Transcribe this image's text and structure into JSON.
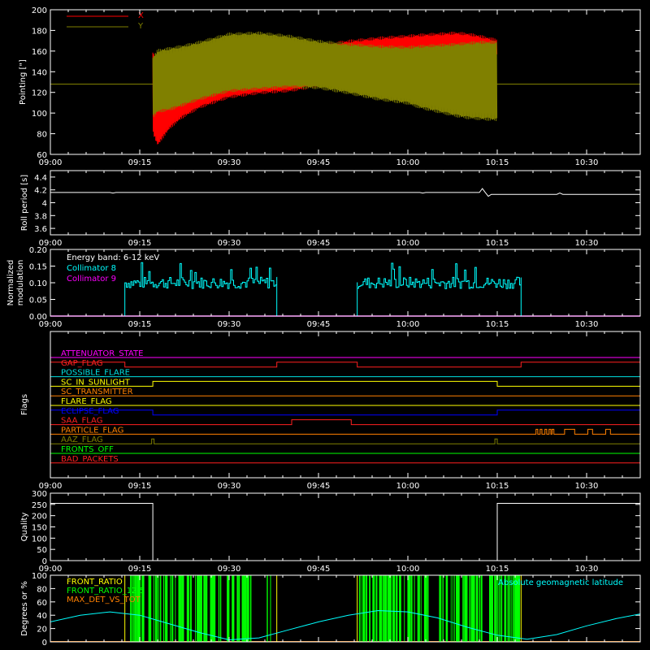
{
  "colors": {
    "background": "#000000",
    "axis": "#ffffff",
    "x_pointing": "#ff0000",
    "y_pointing": "#808000",
    "roll": "#ffffff",
    "collimator8": "#00ffff",
    "collimator9": "#ff00ff",
    "quality": "#ffffff",
    "front_ratio": "#ffff00",
    "front_ratio_125": "#00ff00",
    "max_det": "#ff8000",
    "geomag": "#00ffff"
  },
  "time_axis": {
    "ticks": [
      "09:00",
      "09:15",
      "09:30",
      "09:45",
      "10:00",
      "10:15",
      "10:30"
    ],
    "tick_minutes": [
      0,
      15,
      30,
      45,
      60,
      75,
      90
    ],
    "range_minutes": [
      0,
      99
    ]
  },
  "chart_data": [
    {
      "id": "pointing",
      "type": "line",
      "ylabel": "Pointing [\"]",
      "ylim": [
        60,
        200
      ],
      "yticks": [
        60,
        80,
        100,
        120,
        140,
        160,
        180,
        200
      ],
      "legend": [
        "X",
        "Y"
      ],
      "baseline_value": 128,
      "data_start_min": 17.2,
      "data_end_min": 75.0,
      "series": [
        {
          "name": "X",
          "x": [
            17.2,
            18,
            20,
            22,
            25,
            30,
            35,
            40,
            45,
            50,
            55,
            60,
            62,
            65,
            68,
            70,
            72,
            75
          ],
          "upper": [
            160,
            150,
            150,
            152,
            155,
            160,
            163,
            165,
            167,
            171,
            174,
            176,
            177,
            178,
            179,
            178,
            176,
            172
          ],
          "lower": [
            80,
            68,
            84,
            94,
            104,
            114,
            118,
            120,
            125,
            130,
            134,
            138,
            140,
            141,
            144,
            147,
            150,
            154
          ]
        },
        {
          "name": "Y",
          "x": [
            17.2,
            18,
            20,
            22,
            25,
            30,
            35,
            40,
            45,
            50,
            55,
            60,
            62,
            65,
            68,
            70,
            72,
            75
          ],
          "upper": [
            155,
            162,
            164,
            166,
            170,
            178,
            179,
            176,
            171,
            168,
            166,
            165,
            166,
            167,
            168,
            169,
            170,
            170
          ],
          "lower": [
            95,
            100,
            102,
            106,
            112,
            120,
            122,
            124,
            123,
            118,
            112,
            108,
            104,
            100,
            96,
            94,
            93,
            92
          ]
        }
      ]
    },
    {
      "id": "roll",
      "type": "line",
      "ylabel": "Roll period [s]",
      "ylim": [
        3.5,
        4.5
      ],
      "yticks": [
        3.6,
        3.8,
        4.0,
        4.2,
        4.4
      ],
      "series": [
        {
          "name": "",
          "x": [
            0,
            10,
            10.5,
            11,
            20,
            30,
            40,
            50,
            60,
            62,
            62.5,
            63,
            70,
            72,
            72.5,
            73,
            73.5,
            74,
            80,
            85,
            85.5,
            86,
            99
          ],
          "values": [
            4.16,
            4.16,
            4.15,
            4.16,
            4.16,
            4.16,
            4.16,
            4.16,
            4.16,
            4.16,
            4.15,
            4.16,
            4.16,
            4.16,
            4.22,
            4.16,
            4.1,
            4.13,
            4.13,
            4.13,
            4.15,
            4.13,
            4.13
          ]
        }
      ]
    },
    {
      "id": "modulation",
      "type": "line",
      "ylabel": "Normalized modulation",
      "ylim": [
        0,
        0.2
      ],
      "yticks": [
        "0.00",
        "0.05",
        "0.10",
        "0.15",
        "0.20"
      ],
      "annotation": "Energy band: 6-12 keV",
      "legend": [
        "Collimator 8",
        "Collimator 9"
      ],
      "segments": [
        [
          12.5,
          38.0
        ],
        [
          51.5,
          79.0
        ]
      ],
      "level": 0.1
    },
    {
      "id": "flags",
      "type": "step",
      "ylabel": "Flags",
      "flags": [
        {
          "name": "ATTENUATOR_STATE",
          "color": "#ff00ff",
          "transitions": []
        },
        {
          "name": "GAP_FLAG",
          "color": "#ff2020",
          "transitions": [
            [
              0,
              1
            ],
            [
              12.5,
              0
            ],
            [
              38,
              1
            ],
            [
              51.5,
              0
            ],
            [
              79,
              1
            ]
          ]
        },
        {
          "name": "POSSIBLE_FLARE",
          "color": "#00e0e0",
          "transitions": []
        },
        {
          "name": "SC_IN_SUNLIGHT",
          "color": "#ffff00",
          "transitions": [
            [
              0,
              0
            ],
            [
              17.2,
              1
            ],
            [
              75,
              0
            ]
          ]
        },
        {
          "name": "SC_TRANSMITTER",
          "color": "#ff8000",
          "transitions": []
        },
        {
          "name": "FLARE_FLAG",
          "color": "#ffff00",
          "transitions": []
        },
        {
          "name": "ECLIPSE_FLAG",
          "color": "#0000ff",
          "transitions": [
            [
              0,
              1
            ],
            [
              17.2,
              0
            ],
            [
              75,
              1
            ]
          ]
        },
        {
          "name": "SAA_FLAG",
          "color": "#ff2020",
          "transitions": [
            [
              0,
              0
            ],
            [
              40.5,
              1
            ],
            [
              50.5,
              0
            ]
          ]
        },
        {
          "name": "PARTICLE_FLAG",
          "color": "#ff8000",
          "transitions": [
            [
              0,
              0
            ],
            [
              81.5,
              1
            ],
            [
              81.8,
              0
            ],
            [
              82.2,
              1
            ],
            [
              82.5,
              0
            ],
            [
              83,
              1
            ],
            [
              83.3,
              0
            ],
            [
              83.7,
              1
            ],
            [
              84,
              0
            ],
            [
              84.2,
              1
            ],
            [
              84.5,
              0
            ],
            [
              86.3,
              1
            ],
            [
              88,
              0
            ],
            [
              90.2,
              1
            ],
            [
              91,
              0
            ],
            [
              93.2,
              1
            ],
            [
              94,
              0
            ]
          ]
        },
        {
          "name": "AAZ_FLAG",
          "color": "#808000",
          "transitions": [
            [
              0,
              0
            ],
            [
              17.0,
              1
            ],
            [
              17.4,
              0
            ],
            [
              74.6,
              1
            ],
            [
              75.0,
              0
            ]
          ]
        },
        {
          "name": "FRONTS_OFF",
          "color": "#00ff00",
          "transitions": []
        },
        {
          "name": "BAD_PACKETS",
          "color": "#ff2020",
          "transitions": []
        }
      ]
    },
    {
      "id": "quality",
      "type": "step",
      "ylabel": "Quality",
      "ylim": [
        0,
        300
      ],
      "yticks": [
        0,
        50,
        100,
        150,
        200,
        250,
        300
      ],
      "transitions": [
        [
          0,
          255
        ],
        [
          17.2,
          0
        ],
        [
          75,
          255
        ]
      ]
    },
    {
      "id": "ratios",
      "type": "line",
      "ylabel": "Degrees or %",
      "ylim": [
        0,
        100
      ],
      "yticks": [
        0,
        20,
        40,
        60,
        80,
        100
      ],
      "legend": [
        "FRONT_RATIO",
        "FRONT_RATIO_12.5",
        "MAX_DET_VS_TOT"
      ],
      "annotation": "Absolute geomagnetic latitude",
      "segments": [
        [
          12.5,
          38.0
        ],
        [
          51.5,
          79.0
        ]
      ],
      "geomag": {
        "x": [
          0,
          5,
          10,
          15,
          20,
          25,
          30,
          35,
          40,
          45,
          50,
          55,
          60,
          65,
          70,
          75,
          80,
          85,
          90,
          95,
          99
        ],
        "values": [
          30,
          40,
          45,
          40,
          27,
          14,
          3,
          6,
          18,
          30,
          40,
          47,
          45,
          36,
          22,
          10,
          4,
          11,
          24,
          35,
          42
        ]
      }
    }
  ]
}
